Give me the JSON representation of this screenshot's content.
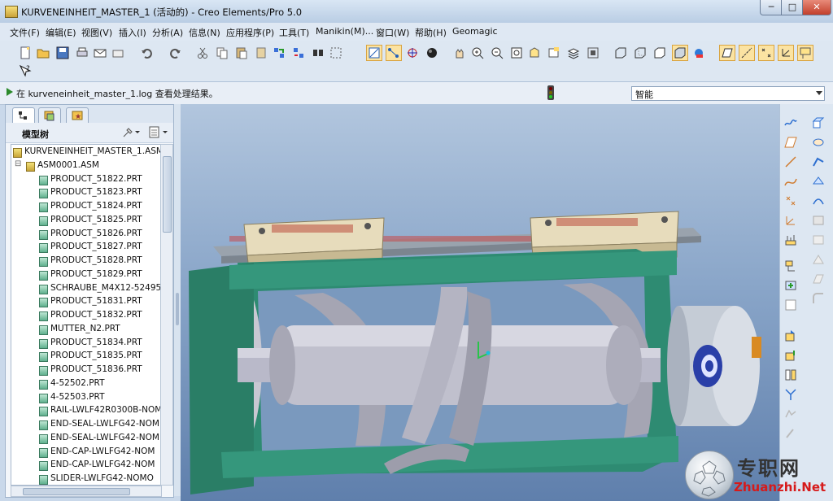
{
  "window": {
    "title": "KURVENEINHEIT_MASTER_1 (活动的) - Creo Elements/Pro 5.0",
    "controls": {
      "minimize": "─",
      "maximize": "□",
      "close": "✕"
    }
  },
  "menu": [
    "文件(F)",
    "编辑(E)",
    "视图(V)",
    "插入(I)",
    "分析(A)",
    "信息(N)",
    "应用程序(P)",
    "工具(T)",
    "Manikin(M)...",
    "窗口(W)",
    "帮助(H)",
    "Geomagic"
  ],
  "message": {
    "text": "在 kurveneinheit_master_1.log 查看处理结果。"
  },
  "filter": {
    "selected": "智能"
  },
  "model_tree": {
    "header": "模型树",
    "items": [
      {
        "label": "KURVENEINHEIT_MASTER_1.ASM",
        "type": "asm",
        "level": 0
      },
      {
        "label": "ASM0001.ASM",
        "type": "asm",
        "level": 1
      },
      {
        "label": "PRODUCT_51822.PRT",
        "type": "prt",
        "level": 2
      },
      {
        "label": "PRODUCT_51823.PRT",
        "type": "prt",
        "level": 2
      },
      {
        "label": "PRODUCT_51824.PRT",
        "type": "prt",
        "level": 2
      },
      {
        "label": "PRODUCT_51825.PRT",
        "type": "prt",
        "level": 2
      },
      {
        "label": "PRODUCT_51826.PRT",
        "type": "prt",
        "level": 2
      },
      {
        "label": "PRODUCT_51827.PRT",
        "type": "prt",
        "level": 2
      },
      {
        "label": "PRODUCT_51828.PRT",
        "type": "prt",
        "level": 2
      },
      {
        "label": "PRODUCT_51829.PRT",
        "type": "prt",
        "level": 2
      },
      {
        "label": "SCHRAUBE_M4X12-52495",
        "type": "prt",
        "level": 2
      },
      {
        "label": "PRODUCT_51831.PRT",
        "type": "prt",
        "level": 2
      },
      {
        "label": "PRODUCT_51832.PRT",
        "type": "prt",
        "level": 2
      },
      {
        "label": "MUTTER_N2.PRT",
        "type": "prt",
        "level": 2
      },
      {
        "label": "PRODUCT_51834.PRT",
        "type": "prt",
        "level": 2
      },
      {
        "label": "PRODUCT_51835.PRT",
        "type": "prt",
        "level": 2
      },
      {
        "label": "PRODUCT_51836.PRT",
        "type": "prt",
        "level": 2
      },
      {
        "label": "4-52502.PRT",
        "type": "prt",
        "level": 2
      },
      {
        "label": "4-52503.PRT",
        "type": "prt",
        "level": 2
      },
      {
        "label": "RAIL-LWLF42R0300B-NOM",
        "type": "prt",
        "level": 2
      },
      {
        "label": "END-SEAL-LWLFG42-NOM",
        "type": "prt",
        "level": 2
      },
      {
        "label": "END-SEAL-LWLFG42-NOM",
        "type": "prt",
        "level": 2
      },
      {
        "label": "END-CAP-LWLFG42-NOM",
        "type": "prt",
        "level": 2
      },
      {
        "label": "END-CAP-LWLFG42-NOM",
        "type": "prt",
        "level": 2
      },
      {
        "label": "SLIDER-LWLFG42-NOMO",
        "type": "prt",
        "level": 2
      }
    ]
  },
  "watermark": {
    "cn": "专职网",
    "url": "Zhuanzhi.Net"
  },
  "colors": {
    "frame": "#2e8b72",
    "carriage": "#e3d8b8",
    "shaft": "#b9b9c9",
    "motor": "#c8ced8",
    "coupling": "#2a3fa8"
  }
}
